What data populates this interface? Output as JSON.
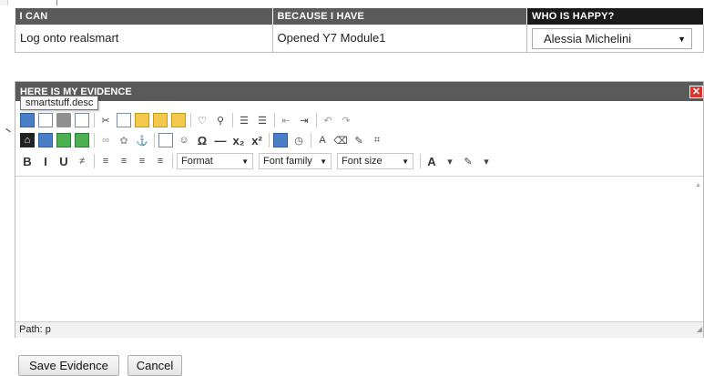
{
  "table": {
    "headers": [
      "I CAN",
      "BECAUSE I HAVE",
      "WHO IS HAPPY?"
    ],
    "row": {
      "i_can": "Log onto realsmart",
      "because": "Opened Y7 Module1",
      "who_selected": "Alessia Michelini"
    }
  },
  "evidence": {
    "title": "HERE IS MY EVIDENCE",
    "close_glyph": "✕",
    "tooltip": "smartstuff.desc",
    "format_label": "Format",
    "font_family_label": "Font family",
    "font_size_label": "Font size",
    "path_label": "Path: p"
  },
  "buttons": {
    "save": "Save Evidence",
    "cancel": "Cancel"
  },
  "colors": {
    "header_bg": "#5a5a5a",
    "header_dark": "#1a1a1a",
    "close_red": "#d9332b"
  }
}
